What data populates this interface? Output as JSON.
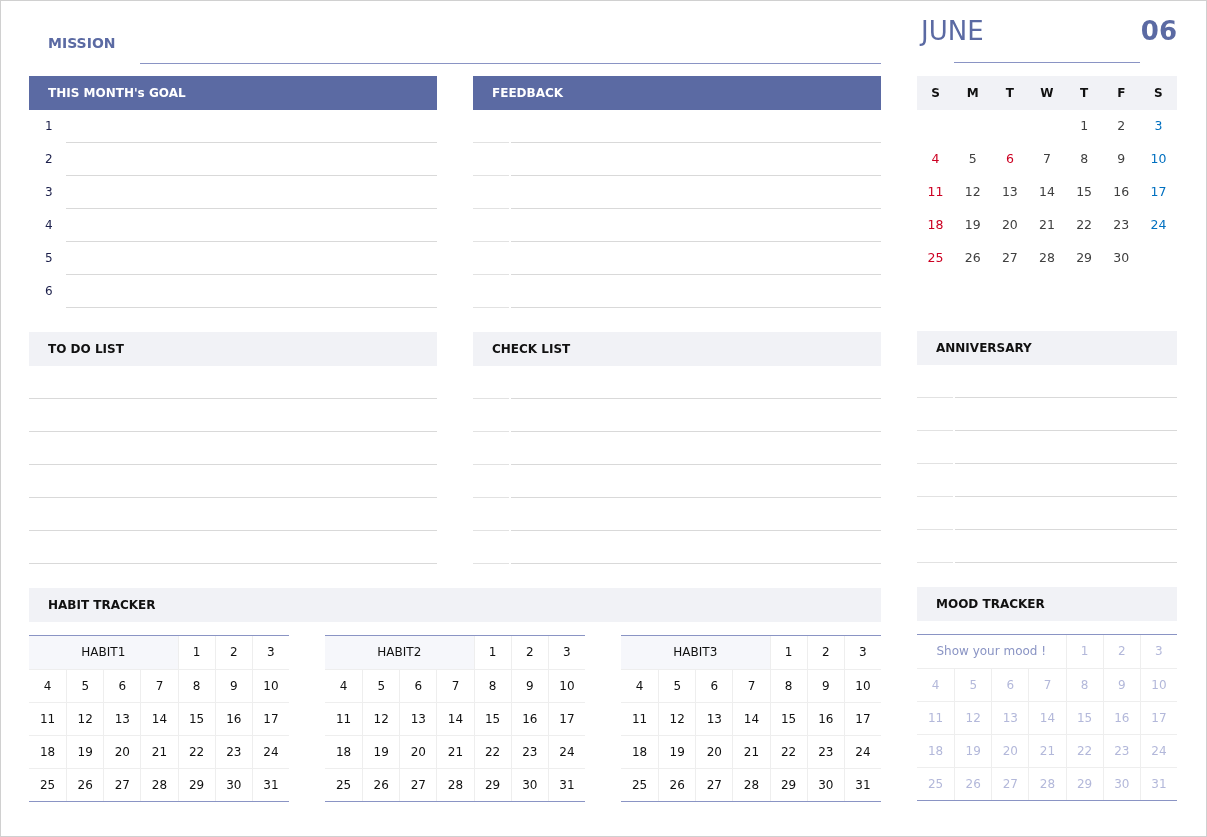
{
  "mission": {
    "label": "MISSION"
  },
  "goal": {
    "title": "THIS MONTH's GOAL",
    "numbers": [
      "1",
      "2",
      "3",
      "4",
      "5",
      "6"
    ]
  },
  "feedback": {
    "title": "FEEDBACK"
  },
  "calendar": {
    "month": "JUNE",
    "number": "06",
    "weekdays": [
      "S",
      "M",
      "T",
      "W",
      "T",
      "F",
      "S"
    ],
    "weeks": [
      [
        {
          "day": "1",
          "color": "#404040"
        },
        {
          "day": "2",
          "color": "#404040"
        },
        {
          "day": "3",
          "color": "#0070c0"
        }
      ],
      [
        {
          "day": "4",
          "color": "#cc0022"
        },
        {
          "day": "5",
          "color": "#404040"
        },
        {
          "day": "6",
          "color": "#cc0022"
        },
        {
          "day": "7",
          "color": "#404040"
        },
        {
          "day": "8",
          "color": "#404040"
        },
        {
          "day": "9",
          "color": "#404040"
        },
        {
          "day": "10",
          "color": "#0070c0"
        }
      ],
      [
        {
          "day": "11",
          "color": "#cc0022"
        },
        {
          "day": "12",
          "color": "#404040"
        },
        {
          "day": "13",
          "color": "#404040"
        },
        {
          "day": "14",
          "color": "#404040"
        },
        {
          "day": "15",
          "color": "#404040"
        },
        {
          "day": "16",
          "color": "#404040"
        },
        {
          "day": "17",
          "color": "#0070c0"
        }
      ],
      [
        {
          "day": "18",
          "color": "#cc0022"
        },
        {
          "day": "19",
          "color": "#404040"
        },
        {
          "day": "20",
          "color": "#404040"
        },
        {
          "day": "21",
          "color": "#404040"
        },
        {
          "day": "22",
          "color": "#404040"
        },
        {
          "day": "23",
          "color": "#404040"
        },
        {
          "day": "24",
          "color": "#0070c0"
        }
      ],
      [
        {
          "day": "25",
          "color": "#cc0022"
        },
        {
          "day": "26",
          "color": "#404040"
        },
        {
          "day": "27",
          "color": "#404040"
        },
        {
          "day": "28",
          "color": "#404040"
        },
        {
          "day": "29",
          "color": "#404040"
        },
        {
          "day": "30",
          "color": "#404040"
        }
      ]
    ]
  },
  "todo": {
    "title": "TO DO LIST"
  },
  "checklist": {
    "title": "CHECK LIST"
  },
  "anniversary": {
    "title": "ANNIVERSARY"
  },
  "habit_tracker": {
    "title": "HABIT TRACKER",
    "habits": [
      {
        "title": "HABIT1",
        "days": [
          "1",
          "2",
          "3",
          "4",
          "5",
          "6",
          "7",
          "8",
          "9",
          "10",
          "11",
          "12",
          "13",
          "14",
          "15",
          "16",
          "17",
          "18",
          "19",
          "20",
          "21",
          "22",
          "23",
          "24",
          "25",
          "26",
          "27",
          "28",
          "29",
          "30",
          "31"
        ]
      },
      {
        "title": "HABIT2",
        "days": [
          "1",
          "2",
          "3",
          "4",
          "5",
          "6",
          "7",
          "8",
          "9",
          "10",
          "11",
          "12",
          "13",
          "14",
          "15",
          "16",
          "17",
          "18",
          "19",
          "20",
          "21",
          "22",
          "23",
          "24",
          "25",
          "26",
          "27",
          "28",
          "29",
          "30",
          "31"
        ]
      },
      {
        "title": "HABIT3",
        "days": [
          "1",
          "2",
          "3",
          "4",
          "5",
          "6",
          "7",
          "8",
          "9",
          "10",
          "11",
          "12",
          "13",
          "14",
          "15",
          "16",
          "17",
          "18",
          "19",
          "20",
          "21",
          "22",
          "23",
          "24",
          "25",
          "26",
          "27",
          "28",
          "29",
          "30",
          "31"
        ]
      }
    ]
  },
  "mood_tracker": {
    "title": "MOOD TRACKER",
    "prompt": "Show your mood !",
    "days": [
      "1",
      "2",
      "3",
      "4",
      "5",
      "6",
      "7",
      "8",
      "9",
      "10",
      "11",
      "12",
      "13",
      "14",
      "15",
      "16",
      "17",
      "18",
      "19",
      "20",
      "21",
      "22",
      "23",
      "24",
      "25",
      "26",
      "27",
      "28",
      "29",
      "30",
      "31"
    ]
  }
}
